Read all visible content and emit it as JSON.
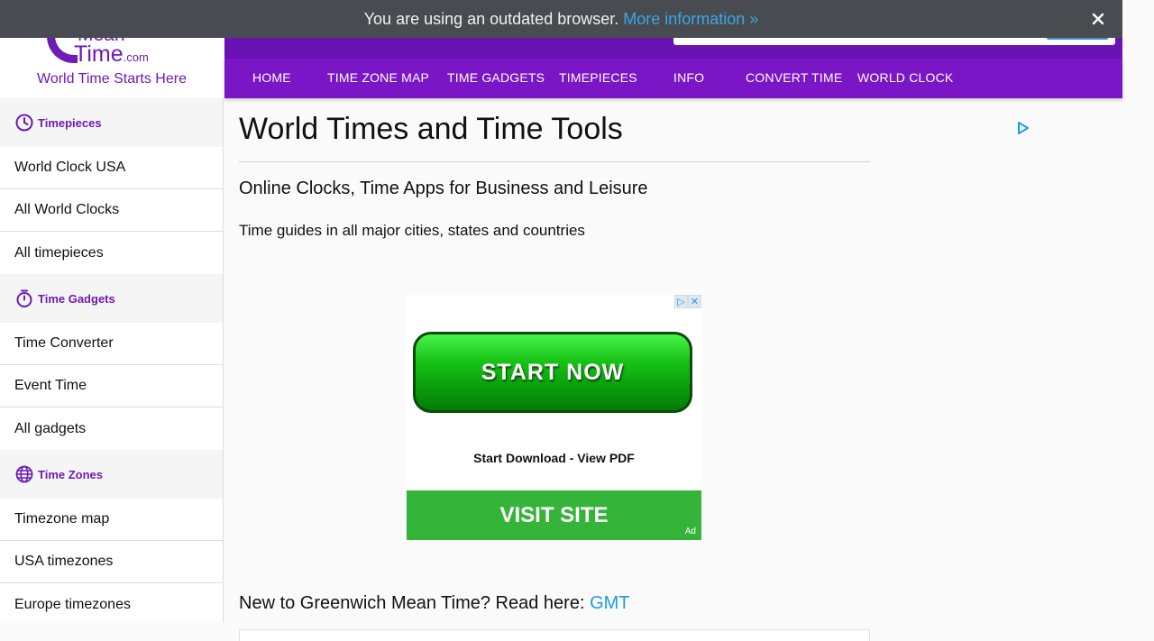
{
  "banner": {
    "message": "You are using an outdated browser.",
    "more_link": "More information »"
  },
  "logo": {
    "line1": "Mean",
    "line2": "Time",
    "suffix": ".com",
    "tagline": "World Time Starts Here"
  },
  "nav": {
    "items": [
      "HOME",
      "TIME ZONE MAP",
      "TIME GADGETS",
      "TIMEPIECES",
      "INFO",
      "CONVERT TIME",
      "WORLD CLOCK"
    ]
  },
  "sidebar": {
    "sections": [
      {
        "title": "Timepieces",
        "icon": "clock-icon",
        "links": [
          "World Clock USA",
          "All World Clocks",
          "All timepieces"
        ]
      },
      {
        "title": "Time Gadgets",
        "icon": "stopwatch-icon",
        "links": [
          "Time Converter",
          "Event Time",
          "All gadgets"
        ]
      },
      {
        "title": "Time Zones",
        "icon": "globe-icon",
        "links": [
          "Timezone map",
          "USA timezones",
          "Europe timezones"
        ]
      }
    ]
  },
  "main": {
    "title": "World Times and Time Tools",
    "subtitle": "Online Clocks, Time Apps for Business and Leisure",
    "description": "Time guides in all major cities, states and countries",
    "gmt_text": "New to Greenwich Mean Time? Read here:",
    "gmt_link": "GMT"
  },
  "ad": {
    "start_button": "START NOW",
    "text": "Start Download - View PDF",
    "visit_button": "VISIT SITE",
    "label": "Ad"
  },
  "colors": {
    "brand_purple": "#6f1bb5",
    "nav_purple": "#7a16c6",
    "link_blue": "#1a9de0"
  }
}
